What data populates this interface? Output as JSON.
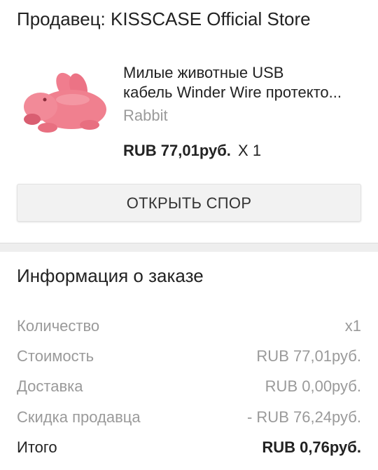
{
  "seller": {
    "label": "Продавец: KISSCASE Official Store"
  },
  "product": {
    "title_line1": "Милые животные USB",
    "title_line2": "кабель Winder Wire протекто...",
    "variant": "Rabbit",
    "price": "RUB 77,01руб.",
    "quantity": "X 1",
    "image_icon": "pink-rabbit-cable-protector"
  },
  "actions": {
    "dispute_label": "ОТКРЫТЬ СПОР"
  },
  "order_info": {
    "title": "Информация о заказе",
    "rows": [
      {
        "label": "Количество",
        "value": "x1"
      },
      {
        "label": "Стоимость",
        "value": "RUB 77,01руб."
      },
      {
        "label": "Доставка",
        "value": "RUB 0,00руб."
      },
      {
        "label": "Скидка продавца",
        "value": "- RUB 76,24руб."
      }
    ],
    "total": {
      "label": "Итого",
      "value": "RUB 0,76руб."
    }
  },
  "colors": {
    "product_pink": "#ef7f8f",
    "muted_text": "#9a9a9a",
    "button_bg": "#f2f2f2"
  }
}
